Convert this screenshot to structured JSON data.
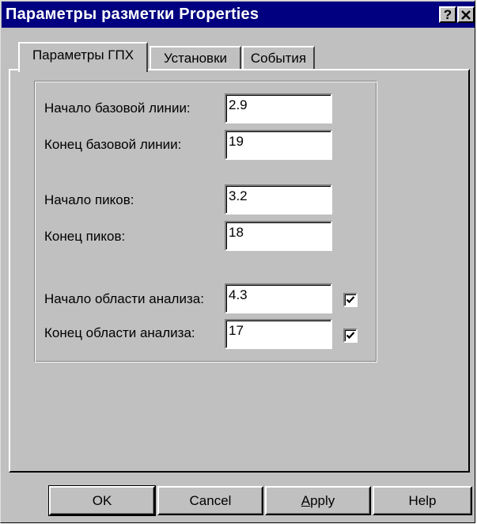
{
  "window": {
    "title": "Параметры разметки Properties",
    "help_button": "?",
    "close_button": "✕"
  },
  "tabs": [
    {
      "label": "Параметры ГПХ",
      "active": true
    },
    {
      "label": "Установки",
      "active": false
    },
    {
      "label": "События",
      "active": false
    }
  ],
  "fields": {
    "baseline_start": {
      "label": "Начало базовой линии:",
      "value": "2.9"
    },
    "baseline_end": {
      "label": "Конец базовой линии:",
      "value": "19"
    },
    "peaks_start": {
      "label": "Начало пиков:",
      "value": "3.2"
    },
    "peaks_end": {
      "label": "Конец пиков:",
      "value": "18"
    },
    "analysis_start": {
      "label": "Начало области анализа:",
      "value": "4.3",
      "checked": true
    },
    "analysis_end": {
      "label": "Конец области анализа:",
      "value": "17",
      "checked": true
    }
  },
  "buttons": {
    "ok": "OK",
    "cancel": "Cancel",
    "apply_first": "A",
    "apply_rest": "pply",
    "help": "Help"
  }
}
